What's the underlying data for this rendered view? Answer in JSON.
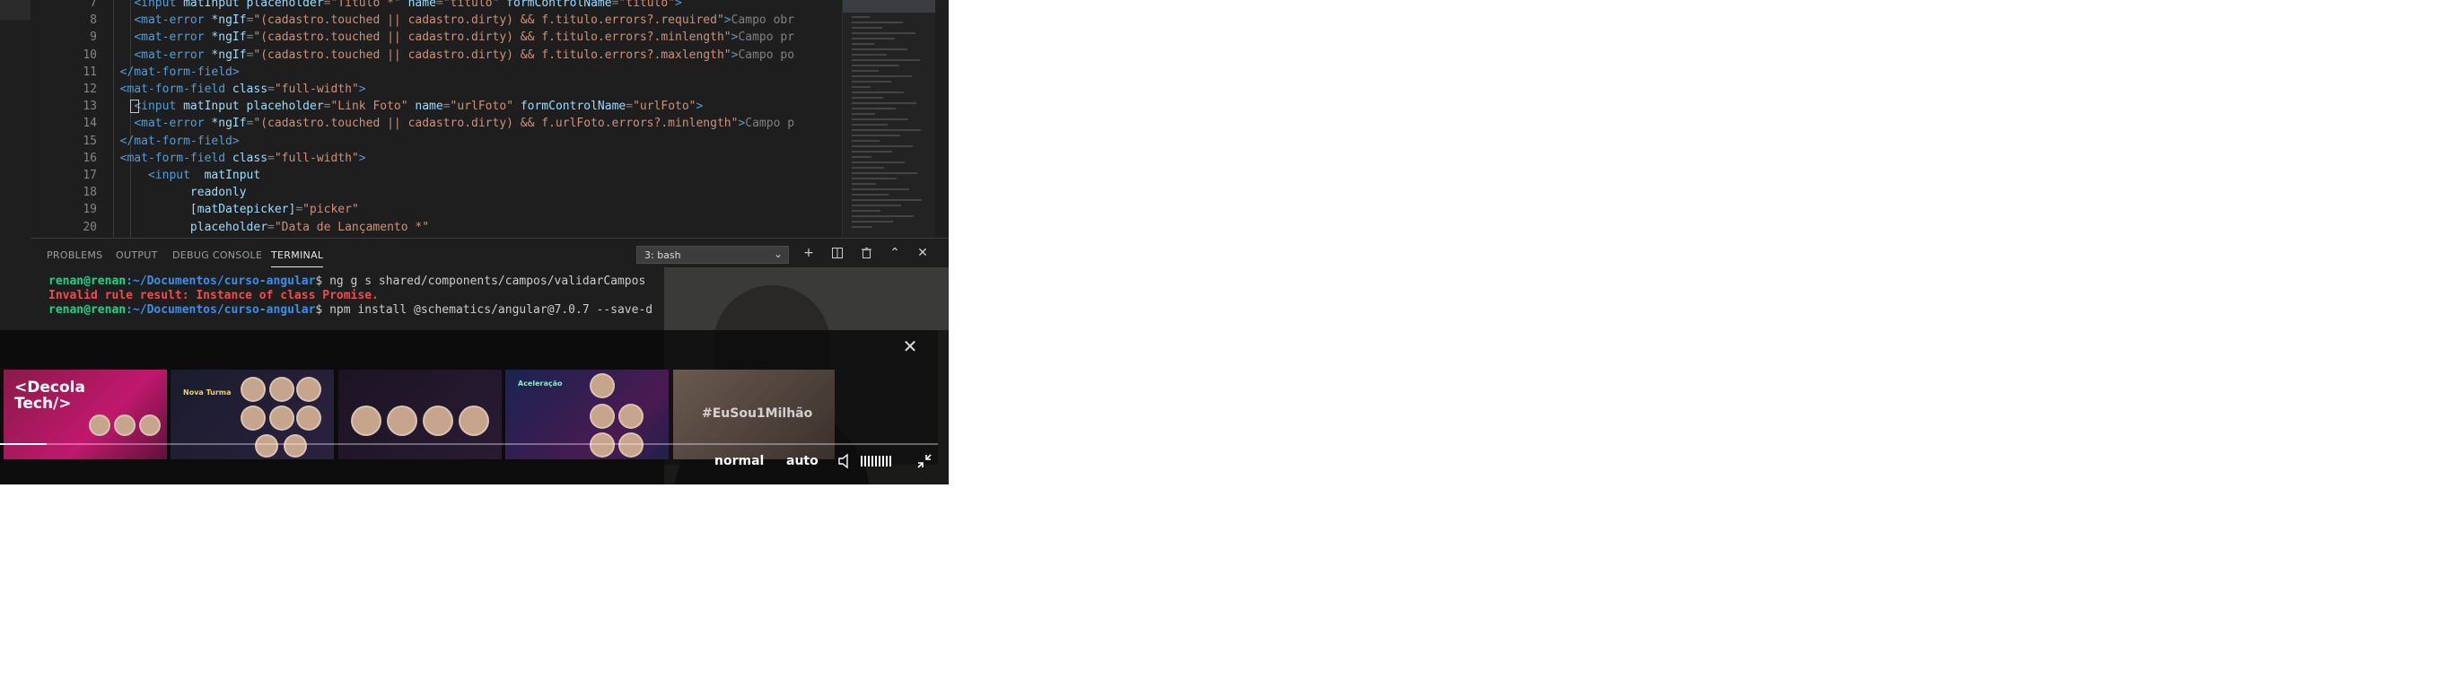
{
  "editor": {
    "line_numbers": [
      "7",
      "8",
      "9",
      "10",
      "11",
      "12",
      "13",
      "14",
      "15",
      "16",
      "17",
      "18",
      "19",
      "20"
    ],
    "lines": [
      [
        {
          "c": "pn",
          "t": "    "
        },
        {
          "c": "tg",
          "t": "<input"
        },
        {
          "c": "at",
          "t": " matInput placeholder"
        },
        {
          "c": "pn",
          "t": "="
        },
        {
          "c": "st",
          "t": "\"Título *\""
        },
        {
          "c": "at",
          "t": " name"
        },
        {
          "c": "pn",
          "t": "="
        },
        {
          "c": "st",
          "t": "\"titulo\""
        },
        {
          "c": "at",
          "t": " formControlName"
        },
        {
          "c": "pn",
          "t": "="
        },
        {
          "c": "st",
          "t": "\"titulo\""
        },
        {
          "c": "tg",
          "t": ">"
        }
      ],
      [
        {
          "c": "pn",
          "t": "    "
        },
        {
          "c": "tg",
          "t": "<mat-error"
        },
        {
          "c": "at",
          "t": " *ngIf"
        },
        {
          "c": "pn",
          "t": "="
        },
        {
          "c": "st",
          "t": "\"(cadastro.touched || cadastro.dirty) && f.titulo.errors?.required\""
        },
        {
          "c": "tg",
          "t": ">"
        },
        {
          "c": "pn",
          "t": "Campo obr"
        }
      ],
      [
        {
          "c": "pn",
          "t": "    "
        },
        {
          "c": "tg",
          "t": "<mat-error"
        },
        {
          "c": "at",
          "t": " *ngIf"
        },
        {
          "c": "pn",
          "t": "="
        },
        {
          "c": "st",
          "t": "\"(cadastro.touched || cadastro.dirty) && f.titulo.errors?.minlength\""
        },
        {
          "c": "tg",
          "t": ">"
        },
        {
          "c": "pn",
          "t": "Campo pr"
        }
      ],
      [
        {
          "c": "pn",
          "t": "    "
        },
        {
          "c": "tg",
          "t": "<mat-error"
        },
        {
          "c": "at",
          "t": " *ngIf"
        },
        {
          "c": "pn",
          "t": "="
        },
        {
          "c": "st",
          "t": "\"(cadastro.touched || cadastro.dirty) && f.titulo.errors?.maxlength\""
        },
        {
          "c": "tg",
          "t": ">"
        },
        {
          "c": "pn",
          "t": "Campo po"
        }
      ],
      [
        {
          "c": "pn",
          "t": "  "
        },
        {
          "c": "tg",
          "t": "</mat-form-field>"
        }
      ],
      [
        {
          "c": "pn",
          "t": "  "
        },
        {
          "c": "tg",
          "t": "<mat-form-field"
        },
        {
          "c": "at",
          "t": " class"
        },
        {
          "c": "pn",
          "t": "="
        },
        {
          "c": "st",
          "t": "\"full-width\""
        },
        {
          "c": "tg",
          "t": ">"
        }
      ],
      [
        {
          "c": "pn",
          "t": "    "
        },
        {
          "c": "tg",
          "t": "<input"
        },
        {
          "c": "at",
          "t": " matInput placeholder"
        },
        {
          "c": "pn",
          "t": "="
        },
        {
          "c": "st",
          "t": "\"Link Foto\""
        },
        {
          "c": "at",
          "t": " name"
        },
        {
          "c": "pn",
          "t": "="
        },
        {
          "c": "st",
          "t": "\"urlFoto\""
        },
        {
          "c": "at",
          "t": " formControlName"
        },
        {
          "c": "pn",
          "t": "="
        },
        {
          "c": "st",
          "t": "\"urlFoto\""
        },
        {
          "c": "tg",
          "t": ">"
        }
      ],
      [
        {
          "c": "pn",
          "t": "    "
        },
        {
          "c": "tg",
          "t": "<mat-error"
        },
        {
          "c": "at",
          "t": " *ngIf"
        },
        {
          "c": "pn",
          "t": "="
        },
        {
          "c": "st",
          "t": "\"(cadastro.touched || cadastro.dirty) && f.urlFoto.errors?.minlength\""
        },
        {
          "c": "tg",
          "t": ">"
        },
        {
          "c": "pn",
          "t": "Campo p"
        }
      ],
      [
        {
          "c": "pn",
          "t": "  "
        },
        {
          "c": "tg",
          "t": "</mat-form-field>"
        }
      ],
      [
        {
          "c": "pn",
          "t": "  "
        },
        {
          "c": "tg",
          "t": "<mat-form-field"
        },
        {
          "c": "at",
          "t": " class"
        },
        {
          "c": "pn",
          "t": "="
        },
        {
          "c": "st",
          "t": "\"full-width\""
        },
        {
          "c": "tg",
          "t": ">"
        }
      ],
      [
        {
          "c": "pn",
          "t": "      "
        },
        {
          "c": "tg",
          "t": "<input"
        },
        {
          "c": "at",
          "t": "  matInput"
        }
      ],
      [
        {
          "c": "pn",
          "t": "            "
        },
        {
          "c": "at",
          "t": "readonly"
        }
      ],
      [
        {
          "c": "pn",
          "t": "            "
        },
        {
          "c": "at",
          "t": "[matDatepicker]"
        },
        {
          "c": "pn",
          "t": "="
        },
        {
          "c": "st",
          "t": "\"picker\""
        }
      ],
      [
        {
          "c": "pn",
          "t": "            "
        },
        {
          "c": "at",
          "t": "placeholder"
        },
        {
          "c": "pn",
          "t": "="
        },
        {
          "c": "st",
          "t": "\"Data de Lançamento *\""
        }
      ]
    ]
  },
  "panel": {
    "tabs": [
      "PROBLEMS",
      "OUTPUT",
      "DEBUG CONSOLE",
      "TERMINAL"
    ],
    "active_tab": "TERMINAL",
    "terminal_select": "3: bash",
    "terminal_lines": [
      {
        "user": "renan@renan",
        "path": ":~/Documentos/curso-angular",
        "cmd": "$ ng g s shared/components/campos/validarCampos"
      },
      {
        "error": "Invalid rule result: Instance of class Promise."
      },
      {
        "user": "renan@renan",
        "path": ":~/Documentos/curso-angular",
        "cmd": "$ npm install @schematics/angular@7.0.7 --save-d"
      }
    ]
  },
  "player": {
    "related_videos": [
      {
        "title": "<Decola Tech/>"
      },
      {
        "title": "Nova Turma"
      },
      {
        "title": ""
      },
      {
        "title": "Aceleração"
      },
      {
        "title": "#EuSou1Milhão"
      }
    ],
    "speed_label": "normal",
    "quality_label": "auto",
    "progress": 0.05,
    "volume_bars": 9
  }
}
